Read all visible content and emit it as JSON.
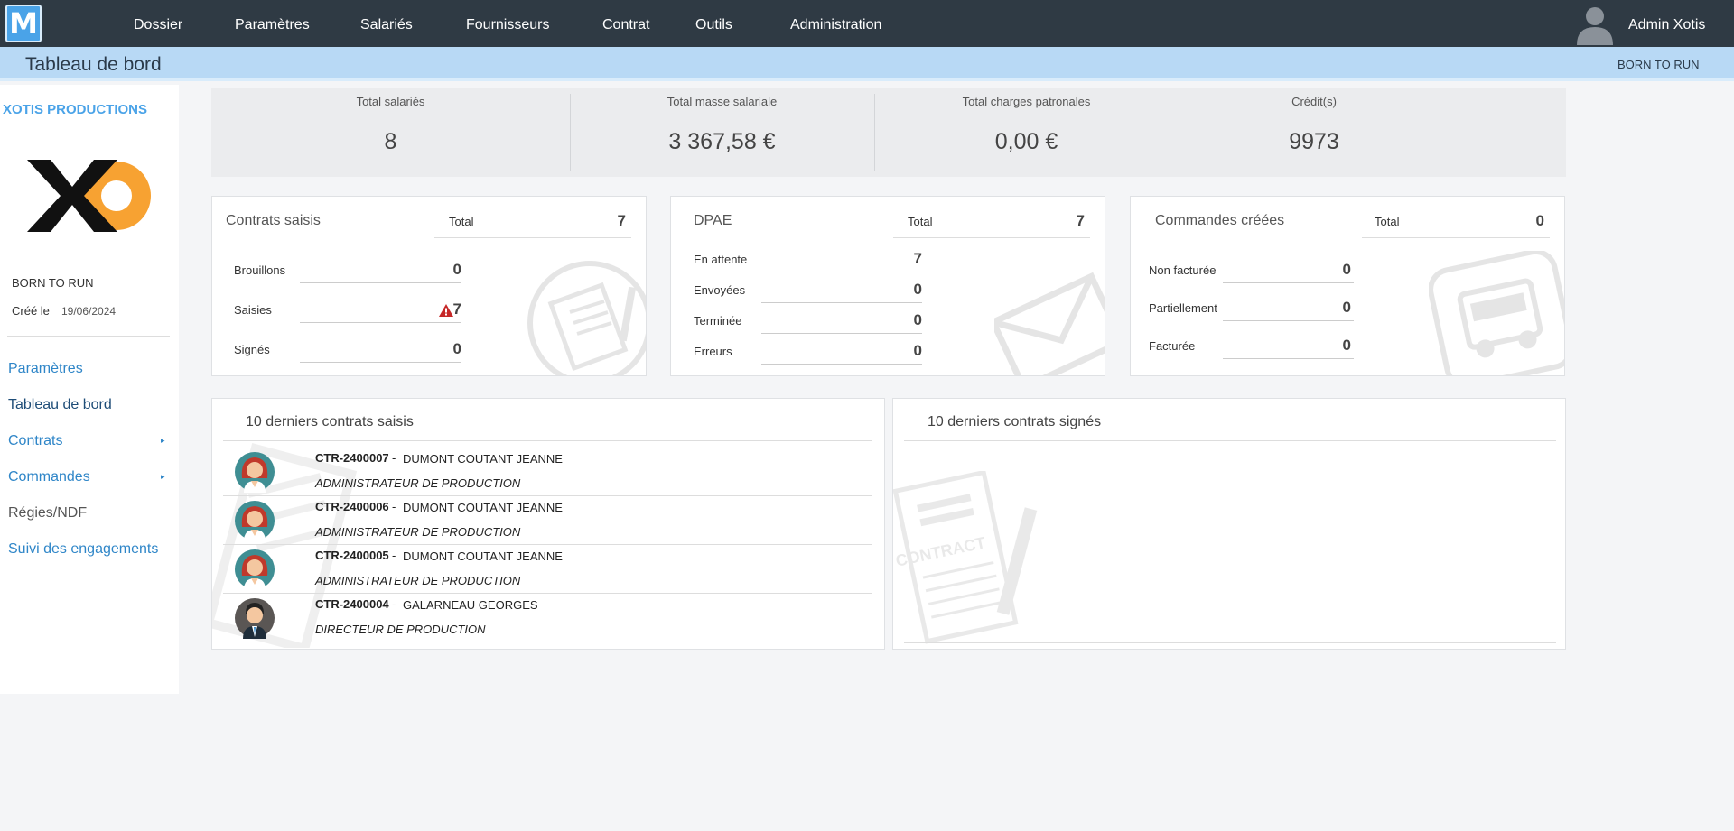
{
  "app": {
    "logo_letter": "M"
  },
  "nav": {
    "items": [
      "Dossier",
      "Paramètres",
      "Salariés",
      "Fournisseurs",
      "Contrat",
      "Outils",
      "Administration"
    ],
    "user_name": "Admin Xotis"
  },
  "titlebar": {
    "title": "Tableau de bord",
    "company": "BORN TO RUN"
  },
  "sidebar": {
    "company_name": "XOTIS PRODUCTIONS",
    "logo_text": "XO",
    "company_label": "BORN TO RUN",
    "created_label": "Créé le",
    "created_date": "19/06/2024",
    "links": [
      "Paramètres",
      "Tableau de bord",
      "Contrats",
      "Commandes",
      "Régies/NDF",
      "Suivi des engagements"
    ]
  },
  "stats": [
    {
      "label": "Total salariés",
      "value": "8"
    },
    {
      "label": "Total masse salariale",
      "value": "3 367,58 €"
    },
    {
      "label": "Total charges patronales",
      "value": "0,00 €"
    },
    {
      "label": "Crédit(s)",
      "value": "9973"
    }
  ],
  "contrats_card": {
    "title": "Contrats saisis",
    "total_label": "Total",
    "total": "7",
    "rows": [
      {
        "label": "Brouillons",
        "value": "0"
      },
      {
        "label": "Saisies",
        "value": "7"
      },
      {
        "label": "Signés",
        "value": "0"
      }
    ]
  },
  "dpae_card": {
    "title": "DPAE",
    "total_label": "Total",
    "total": "7",
    "rows": [
      {
        "label": "En attente",
        "value": "7"
      },
      {
        "label": "Envoyées",
        "value": "0"
      },
      {
        "label": "Terminée",
        "value": "0"
      },
      {
        "label": "Erreurs",
        "value": "0"
      }
    ]
  },
  "commandes_card": {
    "title": "Commandes créées",
    "total_label": "Total",
    "total": "0",
    "rows": [
      {
        "label": "Non facturée",
        "value": "0"
      },
      {
        "label": "Partiellement",
        "value": "0"
      },
      {
        "label": "Facturée",
        "value": "0"
      }
    ]
  },
  "saisis_list": {
    "title": "10 derniers contrats saisis",
    "items": [
      {
        "code": "CTR-2400007",
        "sep": "-",
        "name": "DUMONT COUTANT  JEANNE",
        "role": "ADMINISTRATEUR DE PRODUCTION",
        "avatar": "woman-avatar-icon"
      },
      {
        "code": "CTR-2400006",
        "sep": "-",
        "name": "DUMONT COUTANT  JEANNE",
        "role": "ADMINISTRATEUR DE PRODUCTION",
        "avatar": "woman-avatar-icon"
      },
      {
        "code": "CTR-2400005",
        "sep": "-",
        "name": "DUMONT COUTANT  JEANNE",
        "role": "ADMINISTRATEUR DE PRODUCTION",
        "avatar": "woman-avatar-icon"
      },
      {
        "code": "CTR-2400004",
        "sep": "-",
        "name": "GALARNEAU  GEORGES",
        "role": "DIRECTEUR DE PRODUCTION",
        "avatar": "man-avatar-icon"
      }
    ]
  },
  "signes_list": {
    "title": "10 derniers contrats signés",
    "watermark_text": "CONTRACT"
  },
  "colors": {
    "nav_bg": "#2f3a44",
    "titlebar_bg": "#b8d9f5",
    "accent": "#4aa3e8",
    "link": "#2f86c8",
    "logo_orange": "#f7a232",
    "warning": "#c62828"
  }
}
